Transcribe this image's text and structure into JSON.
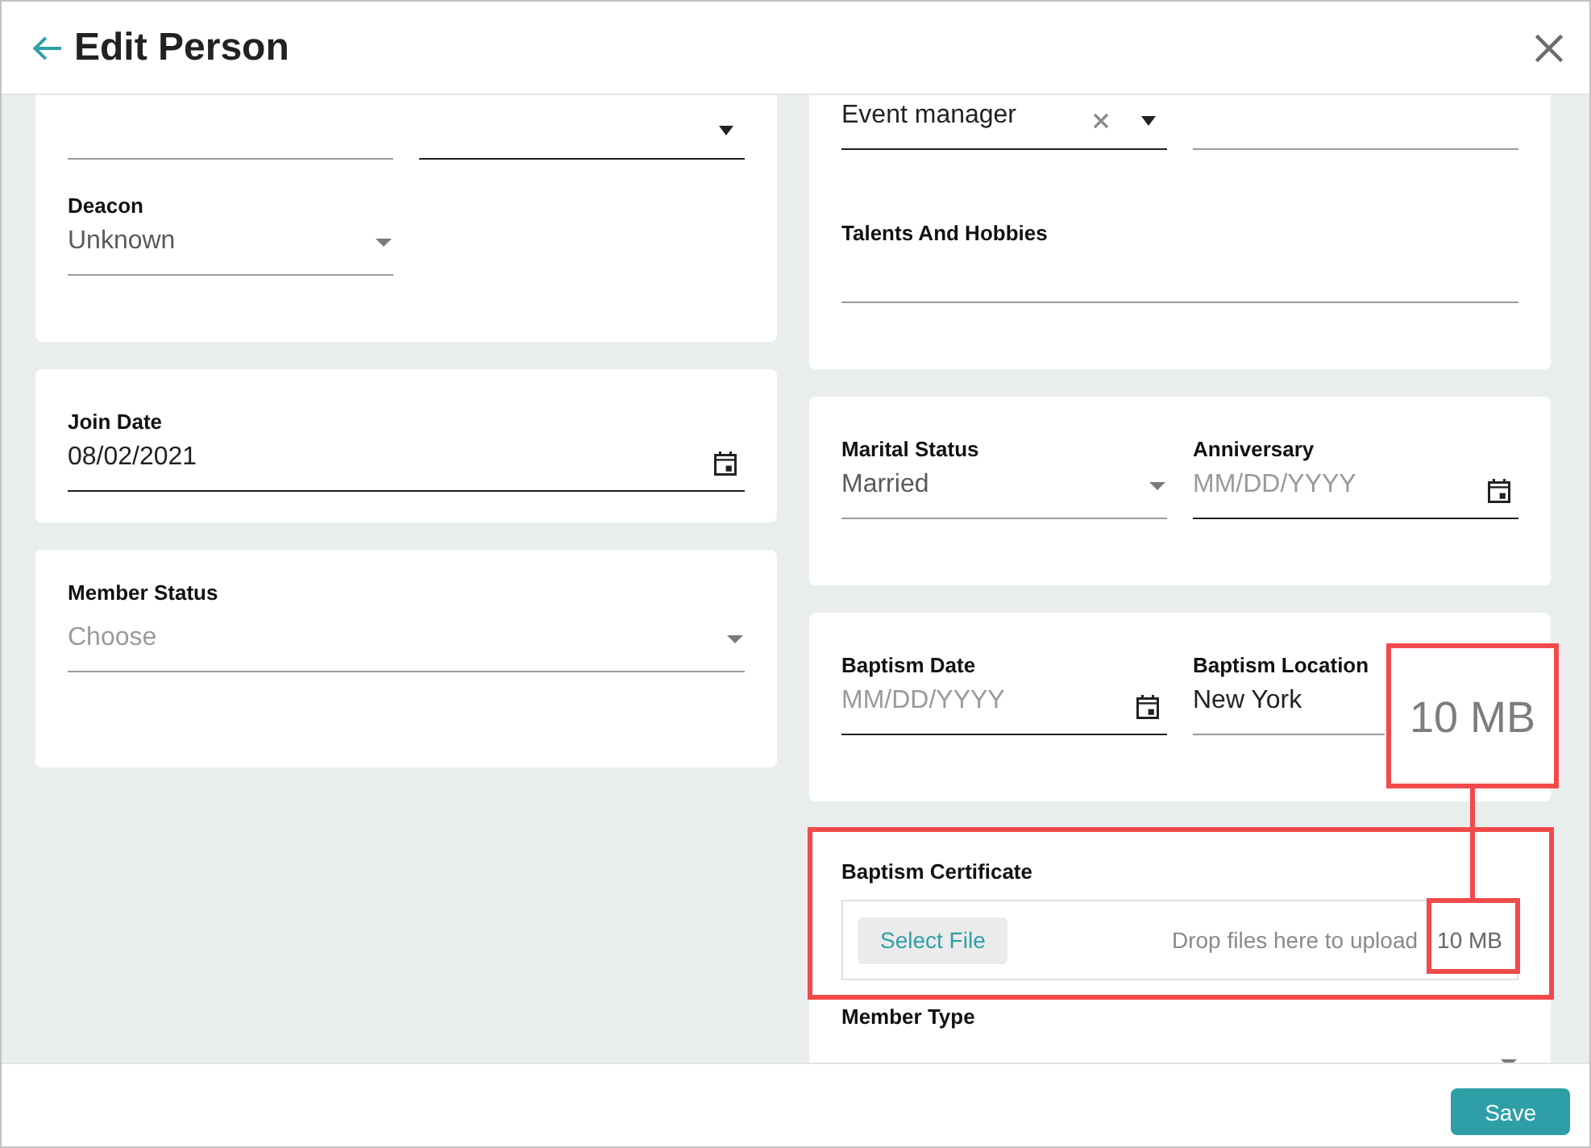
{
  "window": {
    "title": "Edit Person"
  },
  "columns": [
    {
      "cards": [
        {
          "fields": [
            {
              "kind": "text",
              "wide": false
            },
            {
              "kind": "combo",
              "wide": false
            },
            {
              "label": "Deacon",
              "kind": "select",
              "value": "Unknown",
              "wide": false
            }
          ]
        },
        {
          "fields": [
            {
              "label": "Join Date",
              "kind": "date",
              "value": "08/02/2021",
              "wide": true
            }
          ]
        },
        {
          "fields": [
            {
              "label": "Member Status",
              "kind": "select",
              "placeholder": "Choose",
              "wide": true
            }
          ]
        }
      ]
    },
    {
      "cards": [
        {
          "fields": [
            {
              "kind": "combo",
              "value": "Event manager",
              "wide": false
            },
            {
              "kind": "text",
              "wide": false
            },
            {
              "label": "Talents And Hobbies",
              "kind": "textarea",
              "wide": true
            }
          ]
        },
        {
          "fields": [
            {
              "label": "Marital Status",
              "kind": "select",
              "value": "Married",
              "wide": false
            },
            {
              "label": "Anniversary",
              "kind": "date",
              "placeholder": "MM/DD/YYYY",
              "wide": false
            }
          ]
        },
        {
          "fields": [
            {
              "label": "Baptism Date",
              "kind": "date",
              "placeholder": "MM/DD/YYYY",
              "wide": false
            },
            {
              "label": "Baptism Location",
              "kind": "text",
              "value": "New York",
              "wide": false
            }
          ]
        },
        {
          "fields": [
            {
              "label": "Baptism Certificate",
              "kind": "upload",
              "button": "Select File",
              "hint": "Drop files here to upload",
              "limit": "10 MB",
              "wide": true
            },
            {
              "label": "Member Type",
              "kind": "select",
              "wide": true
            }
          ]
        }
      ]
    }
  ],
  "footer": {
    "buttons": [
      {
        "label": "Save",
        "kind": "save"
      }
    ]
  },
  "annotation": {
    "callout": "10 MB"
  }
}
